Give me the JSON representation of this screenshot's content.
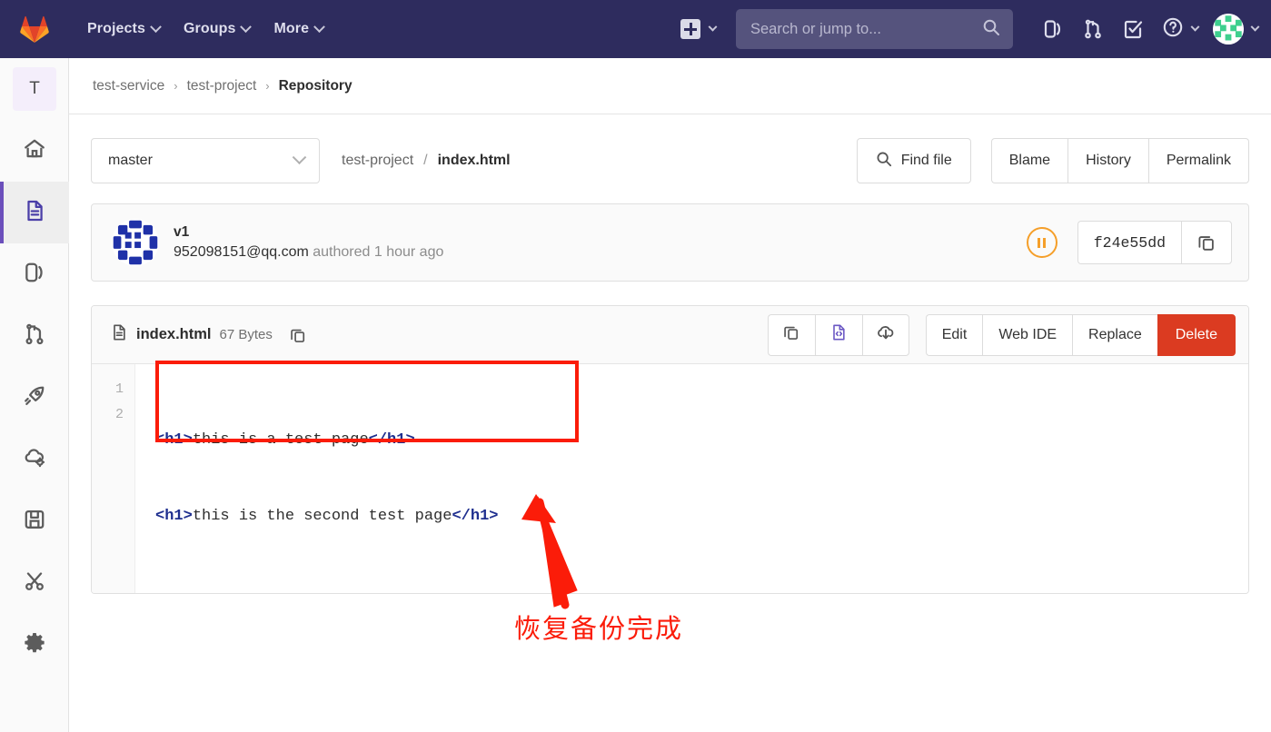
{
  "navbar": {
    "logo_icon": "gitlab-logo-icon",
    "menu": [
      {
        "label": "Projects",
        "icon": "chevron-down-icon"
      },
      {
        "label": "Groups",
        "icon": "chevron-down-icon"
      },
      {
        "label": "More",
        "icon": "chevron-down-icon"
      }
    ],
    "create_new_icon": "plus-square-icon",
    "search": {
      "placeholder": "Search or jump to...",
      "value": "",
      "icon": "search-icon"
    },
    "icons": [
      {
        "name": "issues-icon",
        "title": "Issues"
      },
      {
        "name": "merge-requests-icon",
        "title": "Merge requests"
      },
      {
        "name": "todos-icon",
        "title": "To-Do List"
      },
      {
        "name": "help-icon",
        "title": "Help"
      }
    ],
    "user_avatar_icon": "user-avatar-identicon",
    "bg_color": "#2e2c5e"
  },
  "sidebar": {
    "project_initial": "T",
    "items": [
      {
        "name": "sidebar-item-project-overview",
        "icon": "home-icon",
        "active": false
      },
      {
        "name": "sidebar-item-repository",
        "icon": "file-document-icon",
        "active": true
      },
      {
        "name": "sidebar-item-issues",
        "icon": "issues-icon",
        "active": false
      },
      {
        "name": "sidebar-item-merge-requests",
        "icon": "merge-request-icon",
        "active": false
      },
      {
        "name": "sidebar-item-cicd",
        "icon": "rocket-icon",
        "active": false
      },
      {
        "name": "sidebar-item-operations",
        "icon": "cloud-gear-icon",
        "active": false
      },
      {
        "name": "sidebar-item-packages",
        "icon": "package-icon",
        "active": false
      },
      {
        "name": "sidebar-item-snippets",
        "icon": "scissors-icon",
        "active": false
      },
      {
        "name": "sidebar-item-settings",
        "icon": "gear-icon",
        "active": false
      }
    ],
    "active_accent_color": "#6b4fbb"
  },
  "breadcrumb": {
    "items": [
      {
        "label": "test-service",
        "current": false
      },
      {
        "label": "test-project",
        "current": false
      },
      {
        "label": "Repository",
        "current": true
      }
    ],
    "separator": "›"
  },
  "branch_row": {
    "branch": "master",
    "branch_caret_icon": "chevron-down-icon",
    "path_root": "test-project",
    "path_separator": "/",
    "path_file": "index.html",
    "find_file_label": "Find file",
    "find_file_icon": "search-icon",
    "actions": [
      "Blame",
      "History",
      "Permalink"
    ]
  },
  "commit": {
    "avatar_icon": "commit-author-avatar-identicon",
    "title": "v1",
    "author": "952098151@qq.com",
    "meta_suffix": " authored 1 hour ago",
    "pipeline_status_icon": "pipeline-pending-icon",
    "pipeline_status_color": "#f59f2a",
    "sha": "f24e55dd",
    "sha_copy_icon": "copy-icon"
  },
  "file": {
    "file_icon": "document-icon",
    "name": "index.html",
    "size": "67 Bytes",
    "copy_path_icon": "copy-icon",
    "icon_actions": [
      {
        "name": "copy-file-contents-button",
        "icon": "copy-icon"
      },
      {
        "name": "open-raw-button",
        "icon": "file-code-icon"
      },
      {
        "name": "download-button",
        "icon": "download-cloud-icon"
      }
    ],
    "text_actions": [
      {
        "label": "Edit",
        "danger": false
      },
      {
        "label": "Web IDE",
        "danger": false
      },
      {
        "label": "Replace",
        "danger": false
      },
      {
        "label": "Delete",
        "danger": true
      }
    ],
    "delete_color": "#db3b21",
    "lines": [
      {
        "number": "1",
        "open_tag": "<h1>",
        "text": "this is a test page",
        "close_tag": "</h1>"
      },
      {
        "number": "2",
        "open_tag": "<h1>",
        "text": "this is the second test page",
        "close_tag": "</h1>"
      }
    ]
  },
  "annotation": {
    "caption": "恢复备份完成",
    "color": "#fb1c09",
    "arrow_icon": "annotation-arrow-icon",
    "box_icon": "annotation-highlight-box"
  }
}
